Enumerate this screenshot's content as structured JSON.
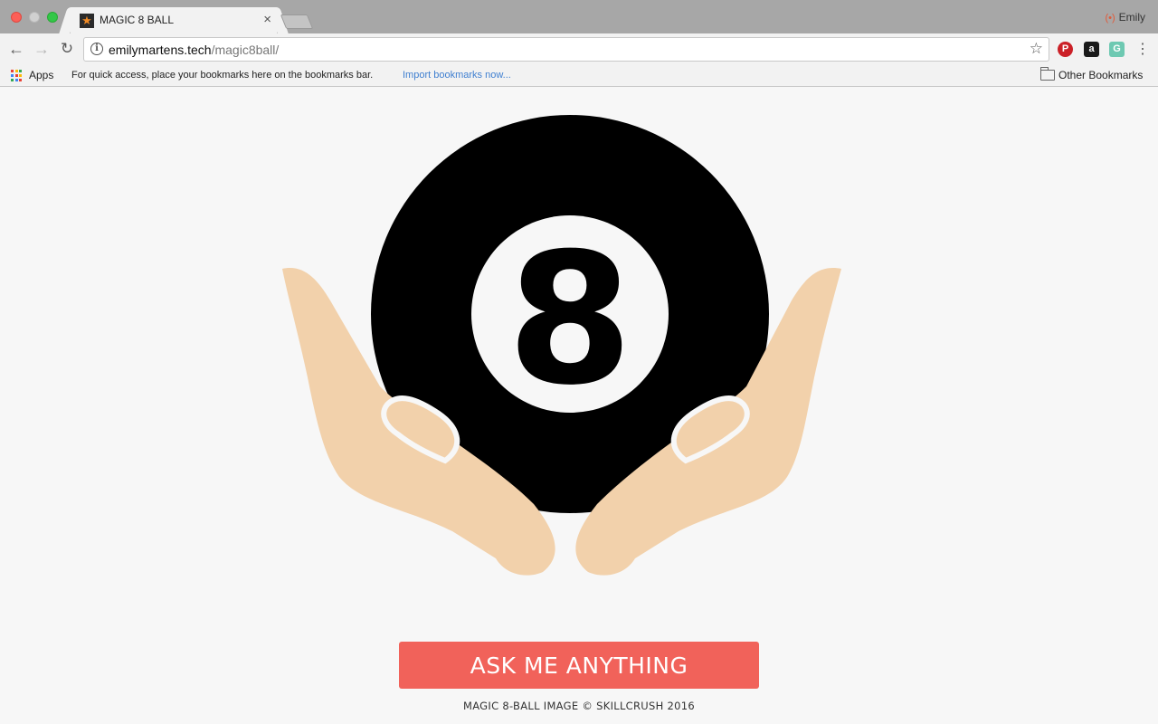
{
  "browser": {
    "tab": {
      "title": "MAGIC 8 BALL",
      "favicon": "star-icon",
      "close_label": "×"
    },
    "profile": {
      "name": "Emily",
      "icon": "profile-icon"
    },
    "address_bar": {
      "host": "emilymartens.tech",
      "path": "/magic8ball/"
    },
    "bookmarks_bar": {
      "apps_label": "Apps",
      "hint": "For quick access, place your bookmarks here on the bookmarks bar.",
      "import_link": "Import bookmarks now...",
      "other_bookmarks": "Other Bookmarks"
    },
    "extensions": [
      {
        "name": "pinterest-icon",
        "glyph": "P",
        "color": "#cb2027"
      },
      {
        "name": "amazon-icon",
        "glyph": "a",
        "color": "#1a1a1a"
      },
      {
        "name": "extension-icon",
        "glyph": "G",
        "color": "#6ec9b2"
      }
    ]
  },
  "page": {
    "ball_number": "8",
    "button_label": "ASK ME ANYTHING",
    "credit": "MAGIC 8-BALL IMAGE © SKILLCRUSH 2016",
    "colors": {
      "background": "#f7f7f7",
      "ball": "#000000",
      "hands": "#f2d1ab",
      "button": "#f1625a",
      "button_text": "#ffffff"
    }
  }
}
